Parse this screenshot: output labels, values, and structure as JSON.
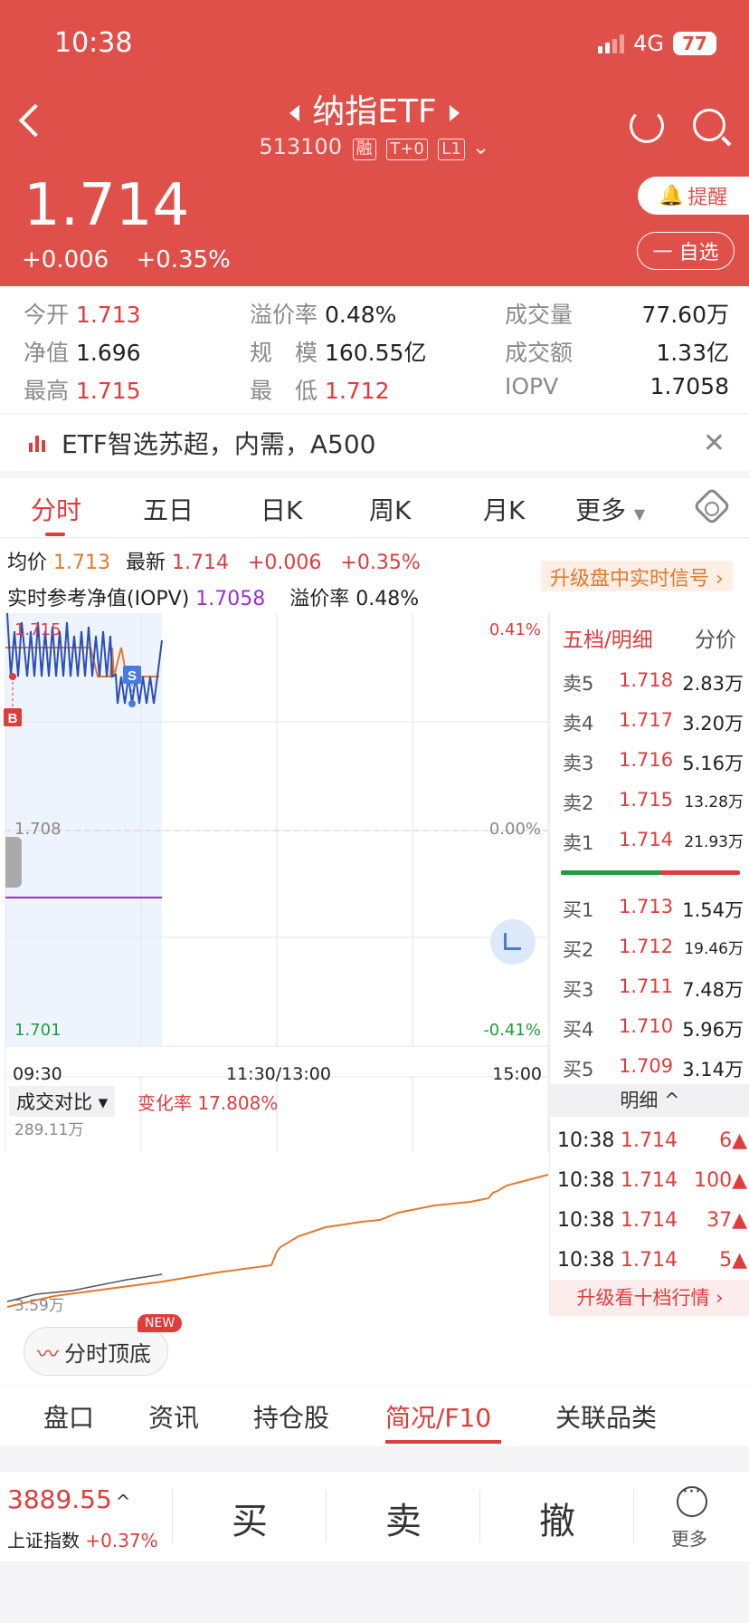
{
  "status": {
    "time": "10:38",
    "network": "4G",
    "battery": "77"
  },
  "header": {
    "title": "纳指ETF",
    "code": "513100",
    "tags": [
      "融",
      "T+0",
      "L1"
    ],
    "price": "1.714",
    "change": "+0.006",
    "change_pct": "+0.35%",
    "remind_label": "提醒",
    "watch_label": "一 自选"
  },
  "stats": {
    "open_label": "今开",
    "open": "1.713",
    "premium_label": "溢价率",
    "premium": "0.48%",
    "volume_label": "成交量",
    "volume": "77.60万",
    "nav_label": "净值",
    "nav": "1.696",
    "scale_label": "规　模",
    "scale": "160.55亿",
    "amount_label": "成交额",
    "amount": "1.33亿",
    "high_label": "最高",
    "high": "1.715",
    "low_label": "最　低",
    "low": "1.712",
    "iopv_label": "IOPV",
    "iopv": "1.7058"
  },
  "notice": {
    "text": "ETF智选苏超，内需，A500"
  },
  "tabs": [
    "分时",
    "五日",
    "日K",
    "周K",
    "月K",
    "更多"
  ],
  "info": {
    "avg_label": "均价",
    "avg": "1.713",
    "latest_label": "最新",
    "latest": "1.714",
    "chg": "+0.006",
    "chg_pct": "+0.35%",
    "iopv_label": "实时参考净值(IOPV)",
    "iopv": "1.7058",
    "premium_label": "溢价率",
    "premium": "0.48%",
    "upgrade": "升级盘中实时信号 ›"
  },
  "chart": {
    "y_top": "1.715",
    "y_mid": "1.708",
    "y_bot": "1.701",
    "pct_top": "0.41%",
    "pct_mid": "0.00%",
    "pct_bot": "-0.41%",
    "times": [
      "09:30",
      "11:30/13:00",
      "15:00"
    ],
    "buy_marker": "B",
    "sell_marker": "S",
    "vol_label": "成交对比 ▾",
    "change_rate_label": "变化率 17.808%",
    "vol_top": "289.11万",
    "vol_bot": "3.59万",
    "colors": {
      "price_line": "#2b4fb8",
      "avg_line": "#e27a2c",
      "iopv_line": "#9a2fd1",
      "up": "#e03c3c",
      "down": "#1f9d3a"
    }
  },
  "book": {
    "header_left": "五档/明细",
    "header_right": "分价",
    "asks": [
      {
        "label": "卖5",
        "price": "1.718",
        "vol": "2.83万"
      },
      {
        "label": "卖4",
        "price": "1.717",
        "vol": "3.20万"
      },
      {
        "label": "卖3",
        "price": "1.716",
        "vol": "5.16万"
      },
      {
        "label": "卖2",
        "price": "1.715",
        "vol": "13.28万"
      },
      {
        "label": "卖1",
        "price": "1.714",
        "vol": "21.93万"
      }
    ],
    "bids": [
      {
        "label": "买1",
        "price": "1.713",
        "vol": "1.54万"
      },
      {
        "label": "买2",
        "price": "1.712",
        "vol": "19.46万"
      },
      {
        "label": "买3",
        "price": "1.711",
        "vol": "7.48万"
      },
      {
        "label": "买4",
        "price": "1.710",
        "vol": "5.96万"
      },
      {
        "label": "买5",
        "price": "1.709",
        "vol": "3.14万"
      }
    ],
    "detail_label": "明细 ^",
    "ticks": [
      {
        "time": "10:38",
        "price": "1.714",
        "vol": "6"
      },
      {
        "time": "10:38",
        "price": "1.714",
        "vol": "100"
      },
      {
        "time": "10:38",
        "price": "1.714",
        "vol": "37"
      },
      {
        "time": "10:38",
        "price": "1.714",
        "vol": "5"
      }
    ],
    "upgrade_ten": "升级看十档行情 ›"
  },
  "chip": {
    "label": "分时顶底",
    "badge": "NEW"
  },
  "bottom_tabs": [
    "盘口",
    "资讯",
    "持仓股",
    "简况/F10",
    "关联品类"
  ],
  "trade": {
    "index_value": "3889.55",
    "index_name": "上证指数",
    "index_chg": "+0.37%",
    "buy": "买",
    "sell": "卖",
    "cancel": "撤",
    "more": "更多"
  }
}
